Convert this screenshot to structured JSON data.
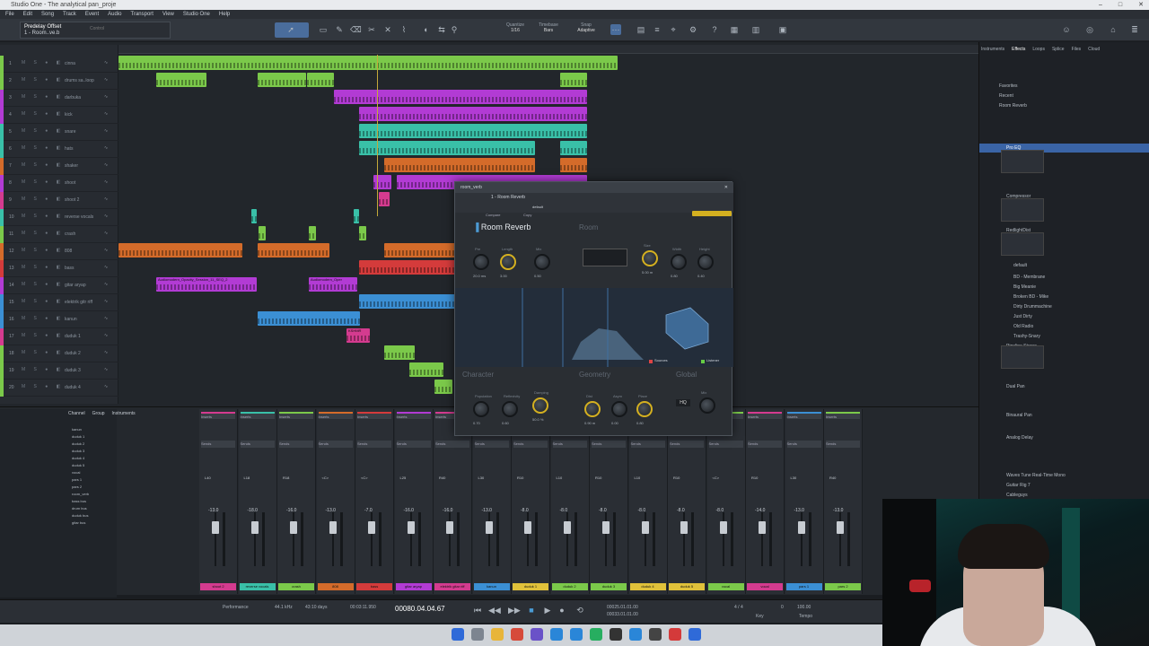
{
  "window": {
    "title": "Studio One - The analytical pan_proje"
  },
  "menu": [
    "File",
    "Edit",
    "Song",
    "Track",
    "Event",
    "Audio",
    "Transport",
    "View",
    "Studio One",
    "Help"
  ],
  "song": {
    "name": "Predelay Offset",
    "track": "1 - Room..ve.b",
    "control": "Control"
  },
  "toolbar": {
    "quantize": "Quantize",
    "q_value": "1/16",
    "timebase": "Timebase",
    "tb_value": "Bars",
    "snap": "Snap",
    "snap_value": "Adaptive"
  },
  "tracks": [
    {
      "n": "1",
      "name": "cinna"
    },
    {
      "n": "2",
      "name": "drums sa..loop"
    },
    {
      "n": "3",
      "name": "darbuka"
    },
    {
      "n": "4",
      "name": "kick"
    },
    {
      "n": "5",
      "name": "snare"
    },
    {
      "n": "6",
      "name": "hats"
    },
    {
      "n": "7",
      "name": "shaker"
    },
    {
      "n": "8",
      "name": "shoot"
    },
    {
      "n": "9",
      "name": "shoot 2"
    },
    {
      "n": "10",
      "name": "reverse vocals"
    },
    {
      "n": "11",
      "name": "crash"
    },
    {
      "n": "12",
      "name": "808"
    },
    {
      "n": "13",
      "name": "bass"
    },
    {
      "n": "14",
      "name": "gitar aryap"
    },
    {
      "n": "15",
      "name": "elektrik gitr riff"
    },
    {
      "n": "16",
      "name": "kanun"
    },
    {
      "n": "17",
      "name": "duduk 1"
    },
    {
      "n": "18",
      "name": "duduk 2"
    },
    {
      "n": "19",
      "name": "duduk 3"
    },
    {
      "n": "20",
      "name": "duduk 4"
    }
  ],
  "clips": {
    "audiomodern1": "Audiomodern_Opacity_Session_11_SEQ_2",
    "audiomodern2": "Audiomodern_Oper",
    "kshmr": "KSHMR",
    "elektrik": "fl_bell_125"
  },
  "plugin": {
    "header": "room_verb",
    "track_label": "1 - Room Reverb",
    "preset": "default",
    "compare": "Compare",
    "copy": "Copy",
    "name": "Room Reverb",
    "room": "Room",
    "character": "Character",
    "geometry": "Geometry",
    "global": "Global",
    "sources": "Sources",
    "listener": "Listener",
    "hq": "HQ",
    "knobs": [
      {
        "label": "Pre",
        "value": "20.0 ms"
      },
      {
        "label": "Length",
        "value": "3.00"
      },
      {
        "label": "Mix",
        "value": "0.50"
      },
      {
        "label": "Size",
        "value": "5.00 m"
      },
      {
        "label": "Width",
        "value": "0.80"
      },
      {
        "label": "Height",
        "value": "0.40"
      },
      {
        "label": "Population",
        "value": "0.70"
      },
      {
        "label": "Reflexivity",
        "value": "0.60"
      },
      {
        "label": "Damping",
        "value": "50.0 %"
      },
      {
        "label": "Dist",
        "value": "0.90 m"
      },
      {
        "label": "Asym",
        "value": "0.00"
      },
      {
        "label": "Place",
        "value": "0.80"
      },
      {
        "label": "Mix",
        "value": ""
      }
    ]
  },
  "browser": {
    "tabs": [
      "Instruments",
      "Effects",
      "Loops",
      "Splice",
      "Files",
      "Cloud"
    ],
    "items": [
      {
        "label": "Favorites",
        "sel": false
      },
      {
        "label": "Recent",
        "sel": false
      },
      {
        "label": "Room Reverb",
        "sel": false
      },
      {
        "label": "Pro EQ",
        "sel": true
      },
      {
        "label": "Compressor",
        "sel": false
      },
      {
        "label": "RedlightDist",
        "sel": false
      },
      {
        "label": "default",
        "sel": false
      },
      {
        "label": "BD - Membrane",
        "sel": false
      },
      {
        "label": "Big Meanie",
        "sel": false
      },
      {
        "label": "Broken BD - Mike",
        "sel": false
      },
      {
        "label": "Dirty Drummachine",
        "sel": false
      },
      {
        "label": "Just Dirty",
        "sel": false
      },
      {
        "label": "Old Radio",
        "sel": false
      },
      {
        "label": "Trashy-Snary",
        "sel": false
      },
      {
        "label": "Pipeline Stereo",
        "sel": false
      },
      {
        "label": "Dual Pan",
        "sel": false
      },
      {
        "label": "Binaural Pan",
        "sel": false
      },
      {
        "label": "Analog Delay",
        "sel": false
      },
      {
        "label": "Waves Tune Real-Time Mono",
        "sel": false
      },
      {
        "label": "Guitar Rig 7",
        "sel": false
      },
      {
        "label": "Cableguys",
        "sel": false
      }
    ]
  },
  "console": {
    "tabs": [
      "Channel",
      "Group",
      "Instruments"
    ],
    "tree": [
      "kanun",
      "duduk 1",
      "duduk 2",
      "duduk 3",
      "duduk 4",
      "duduk 5",
      "vocal",
      "pars 1",
      "pars 2",
      "room_verb",
      "bass bus",
      "drum bus",
      "duduk bus",
      "gitar bus"
    ],
    "channels": [
      {
        "name": "shoot 2",
        "color": "#d43b8f",
        "pan": "L40",
        "vol": "-13.0"
      },
      {
        "name": "reverse vocals",
        "color": "#39c0a8",
        "pan": "L18",
        "vol": "-18.0"
      },
      {
        "name": "crash",
        "color": "#7bc94a",
        "pan": "R18",
        "vol": "-16.0"
      },
      {
        "name": "808",
        "color": "#d46b2a",
        "pan": "<C>",
        "vol": "-13.0"
      },
      {
        "name": "bass",
        "color": "#d43b3b",
        "pan": "<C>",
        "vol": "-7.0"
      },
      {
        "name": "gitar aryap",
        "color": "#b23bd4",
        "pan": "L25",
        "vol": "-16.0"
      },
      {
        "name": "elektrik gitar riff",
        "color": "#d43b8f",
        "pan": "R40",
        "vol": "-16.0"
      },
      {
        "name": "kanun",
        "color": "#3b8fd4",
        "pan": "L30",
        "vol": "-13.0"
      },
      {
        "name": "duduk 1",
        "color": "#e0c13a",
        "pan": "R10",
        "vol": "-8.0"
      },
      {
        "name": "duduk 2",
        "color": "#7bc94a",
        "pan": "L10",
        "vol": "-8.0"
      },
      {
        "name": "duduk 3",
        "color": "#7bc94a",
        "pan": "R10",
        "vol": "-8.0"
      },
      {
        "name": "duduk 4",
        "color": "#e0c13a",
        "pan": "L10",
        "vol": "-8.0"
      },
      {
        "name": "duduk 5",
        "color": "#e0c13a",
        "pan": "R10",
        "vol": "-8.0"
      },
      {
        "name": "vocal",
        "color": "#7bc94a",
        "pan": "<C>",
        "vol": "-8.0"
      },
      {
        "name": "vocal",
        "color": "#d43b8f",
        "pan": "R10",
        "vol": "-14.0"
      },
      {
        "name": "pars 1",
        "color": "#3b8fd4",
        "pan": "L30",
        "vol": "-13.0"
      },
      {
        "name": "pars 2",
        "color": "#7bc94a",
        "pan": "R40",
        "vol": "-13.0"
      }
    ]
  },
  "transport": {
    "sample_rate": "44.1 kHz",
    "record_max": "43:10 days",
    "performance": "Performance",
    "timecode": "00:03:11.950",
    "bars": "00080.04.04.67",
    "loop_start": "00025.01.01.00",
    "loop_end": "00033.01.01.00",
    "signature": "4 / 4",
    "tempo": "100.00",
    "tempo_label": "Tempo",
    "key_label": "Key",
    "key": "0"
  },
  "colors": {
    "accent": "#3a64a6",
    "plugin_knob": "#d4b020"
  }
}
